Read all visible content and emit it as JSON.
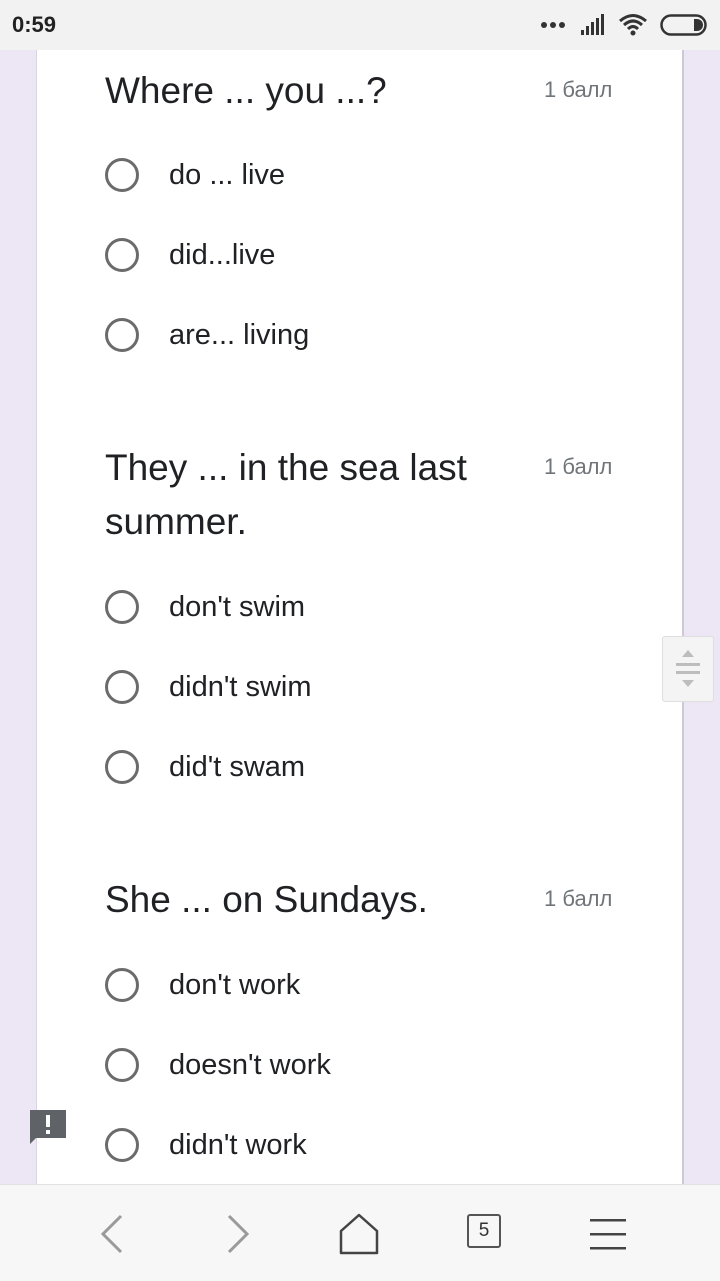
{
  "status_bar": {
    "time": "0:59"
  },
  "questions": [
    {
      "title": "Where ... you ...?",
      "points": "1 балл",
      "options": [
        "do ... live",
        "did...live",
        "are... living"
      ]
    },
    {
      "title": "They ... in the sea last summer.",
      "points": "1 балл",
      "options": [
        "don't swim",
        "didn't swim",
        "did't swam"
      ]
    },
    {
      "title": "She ... on Sundays.",
      "points": "1 балл",
      "options": [
        "don't work",
        "doesn't work",
        "didn't work"
      ]
    }
  ],
  "bottom_nav": {
    "tabs_count": "5"
  },
  "colors": {
    "page_background": "#ede6f4",
    "card_background": "#ffffff",
    "radio_border": "#6b6b6b",
    "points_text": "#70757a"
  },
  "icons": [
    "signal-dots-icon",
    "cell-signal-icon",
    "wifi-icon",
    "battery-icon",
    "scroll-handle-icon",
    "feedback-icon",
    "back-icon",
    "forward-icon",
    "home-icon",
    "menu-icon"
  ]
}
